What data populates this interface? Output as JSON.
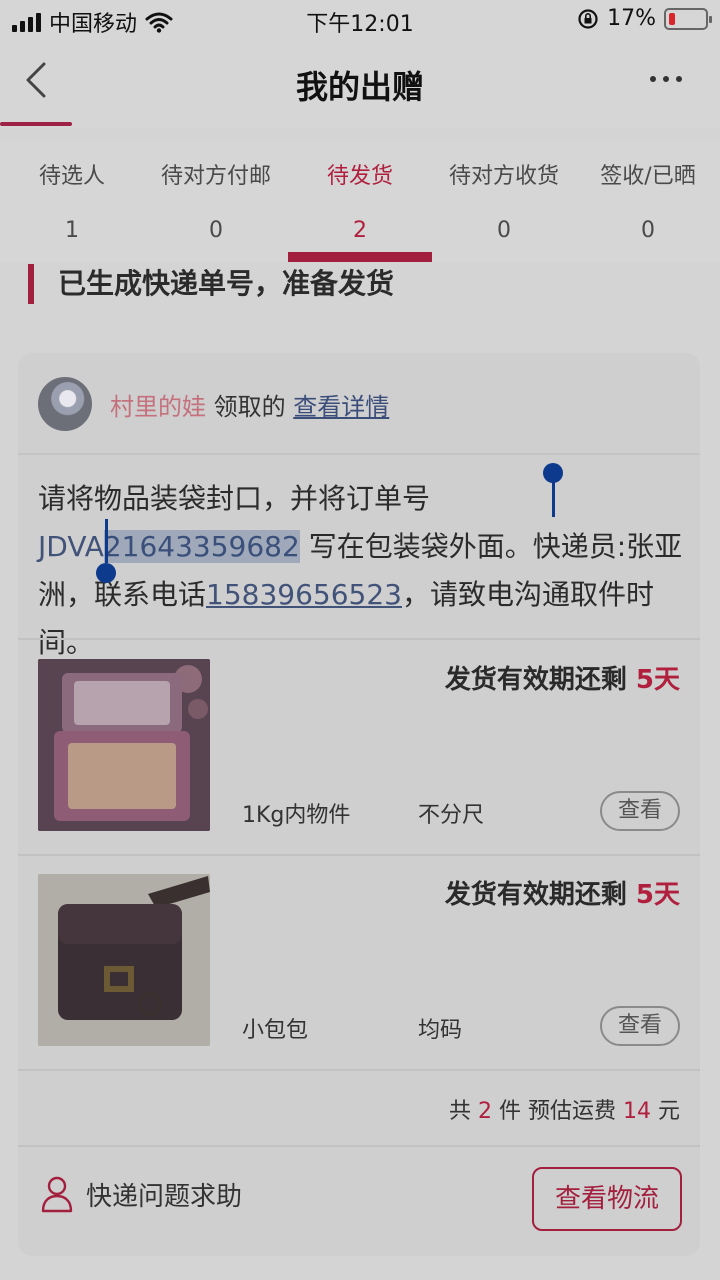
{
  "status_bar": {
    "carrier": "中国移动",
    "time": "下午12:01",
    "battery_percent": "17%"
  },
  "nav": {
    "title": "我的出赠"
  },
  "tabs": [
    {
      "label": "待选人",
      "count": "1",
      "active": false
    },
    {
      "label": "待对方付邮",
      "count": "0",
      "active": false
    },
    {
      "label": "待发货",
      "count": "2",
      "active": true
    },
    {
      "label": "待对方收货",
      "count": "0",
      "active": false
    },
    {
      "label": "签收/已晒",
      "count": "0",
      "active": false
    }
  ],
  "section": {
    "title": "已生成快递单号，准备发货"
  },
  "order": {
    "user_name": "村里的娃",
    "received_text": "领取的",
    "detail_link": "查看详情",
    "instruction_prefix": "请将物品装袋封口，并将订单号 ",
    "order_no_head": "JDVA",
    "order_no_selected": "21643359682",
    "instruction_middle": " 写在包装袋外面。快递员:张亚洲，联系电话",
    "phone": "15839656523",
    "instruction_suffix": "，请致电沟通取件时间。"
  },
  "items": [
    {
      "deadline_prefix": "发货有效期还剩 ",
      "deadline_days": "5天",
      "weight": "1Kg内物件",
      "size": "不分尺",
      "view_label": "查看"
    },
    {
      "deadline_prefix": "发货有效期还剩 ",
      "deadline_days": "5天",
      "weight": "小包包",
      "size": "均码",
      "view_label": "查看"
    }
  ],
  "summary": {
    "prefix": "共 ",
    "count": "2",
    "middle": " 件 预估运费 ",
    "fee": "14",
    "suffix": " 元"
  },
  "footer": {
    "help_label": "快递问题求助",
    "logistics_button": "查看物流"
  },
  "colors": {
    "accent": "#a31f3e",
    "link": "#42537a",
    "selection": "#9fa9b9",
    "handle": "#0d3a8c"
  }
}
